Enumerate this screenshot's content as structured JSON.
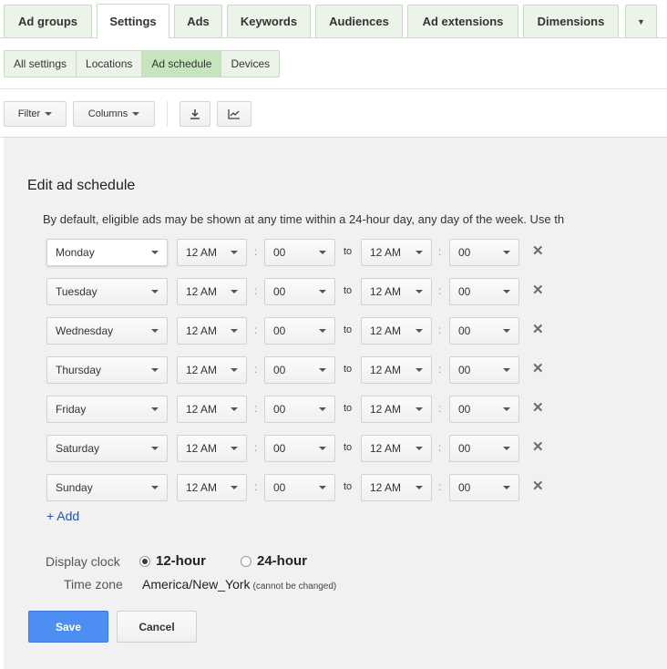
{
  "tabs": [
    {
      "label": "Ad groups",
      "active": false
    },
    {
      "label": "Settings",
      "active": true
    },
    {
      "label": "Ads",
      "active": false
    },
    {
      "label": "Keywords",
      "active": false
    },
    {
      "label": "Audiences",
      "active": false
    },
    {
      "label": "Ad extensions",
      "active": false
    },
    {
      "label": "Dimensions",
      "active": false
    }
  ],
  "subtabs": [
    {
      "label": "All settings",
      "active": false
    },
    {
      "label": "Locations",
      "active": false
    },
    {
      "label": "Ad schedule",
      "active": true
    },
    {
      "label": "Devices",
      "active": false
    }
  ],
  "toolbar": {
    "filter_label": "Filter",
    "columns_label": "Columns",
    "download_icon": "download-icon",
    "chart_icon": "chart-icon"
  },
  "panel": {
    "title": "Edit ad schedule",
    "description": "By default, eligible ads may be shown at any time within a 24-hour day, any day of the week. Use th"
  },
  "schedule": {
    "to_label": "to",
    "colon": ":",
    "rows": [
      {
        "day": "Monday",
        "start_hour": "12 AM",
        "start_min": "00",
        "end_hour": "12 AM",
        "end_min": "00"
      },
      {
        "day": "Tuesday",
        "start_hour": "12 AM",
        "start_min": "00",
        "end_hour": "12 AM",
        "end_min": "00"
      },
      {
        "day": "Wednesday",
        "start_hour": "12 AM",
        "start_min": "00",
        "end_hour": "12 AM",
        "end_min": "00"
      },
      {
        "day": "Thursday",
        "start_hour": "12 AM",
        "start_min": "00",
        "end_hour": "12 AM",
        "end_min": "00"
      },
      {
        "day": "Friday",
        "start_hour": "12 AM",
        "start_min": "00",
        "end_hour": "12 AM",
        "end_min": "00"
      },
      {
        "day": "Saturday",
        "start_hour": "12 AM",
        "start_min": "00",
        "end_hour": "12 AM",
        "end_min": "00"
      },
      {
        "day": "Sunday",
        "start_hour": "12 AM",
        "start_min": "00",
        "end_hour": "12 AM",
        "end_min": "00"
      }
    ],
    "add_label": "+ Add"
  },
  "clock": {
    "label": "Display clock",
    "option_12": "12-hour",
    "option_24": "24-hour",
    "selected": "12-hour"
  },
  "timezone": {
    "label": "Time zone",
    "value": "America/New_York",
    "note": "(cannot be changed)"
  },
  "buttons": {
    "save": "Save",
    "cancel": "Cancel"
  },
  "colors": {
    "tab_bg": "#ecf4ea",
    "subtab_active": "#c6e4be",
    "save_button": "#4d8ef3",
    "link": "#1a57b5"
  }
}
